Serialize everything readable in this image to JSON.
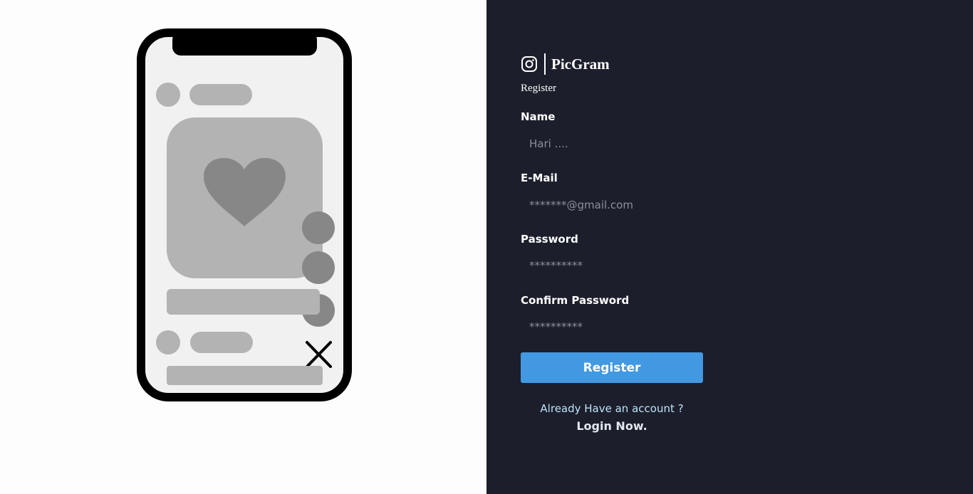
{
  "brand": {
    "name": "PicGram",
    "icon": "instagram-icon"
  },
  "subtitle": "Register",
  "form": {
    "name": {
      "label": "Name",
      "placeholder": "Hari ....",
      "value": ""
    },
    "email": {
      "label": "E-Mail",
      "placeholder": "*******@gmail.com",
      "value": ""
    },
    "password": {
      "label": "Password",
      "placeholder": "**********",
      "value": ""
    },
    "confirm_password": {
      "label": "Confirm Password",
      "placeholder": "**********",
      "value": ""
    },
    "submit_label": "Register"
  },
  "footer": {
    "already_text": "Already Have an account ?",
    "login_label": "Login Now."
  },
  "illustration": {
    "icons": [
      "heart-icon",
      "close-icon"
    ]
  },
  "colors": {
    "panel_bg": "#1c1f2b",
    "button_bg": "#4299e1",
    "page_bg": "#fdfdfd"
  }
}
